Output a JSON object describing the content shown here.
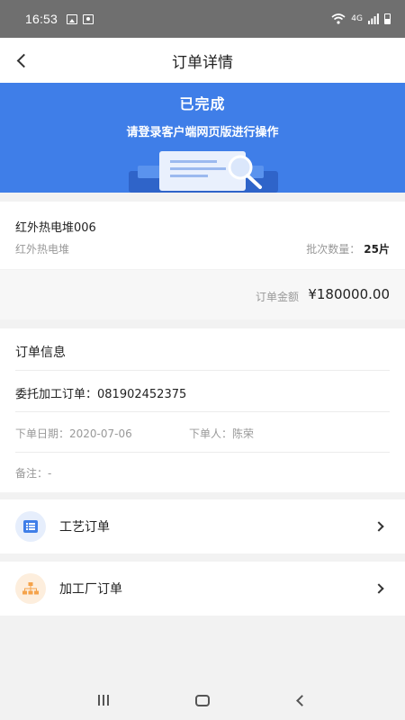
{
  "status_bar": {
    "time": "16:53",
    "network": "4G"
  },
  "nav": {
    "title": "订单详情"
  },
  "banner": {
    "status": "已完成",
    "hint": "请登录客户端网页版进行操作"
  },
  "product": {
    "name": "红外热电堆006",
    "category": "红外热电堆",
    "batch_label": "批次数量：",
    "batch_value": "25片"
  },
  "amount": {
    "label": "订单金额",
    "value": "¥180000.00"
  },
  "order_info": {
    "title": "订单信息",
    "order_no_text": "委托加工订单：081902452375",
    "date_text": "下单日期：2020-07-06",
    "user_text": "下单人：陈荣",
    "remark_text": "备注：-"
  },
  "links": {
    "craft": "工艺订单",
    "factory": "加工厂订单"
  },
  "colors": {
    "banner": "#3f7ee8",
    "accent": "#3f7ee8",
    "factory_icon": "#f5a34a"
  }
}
